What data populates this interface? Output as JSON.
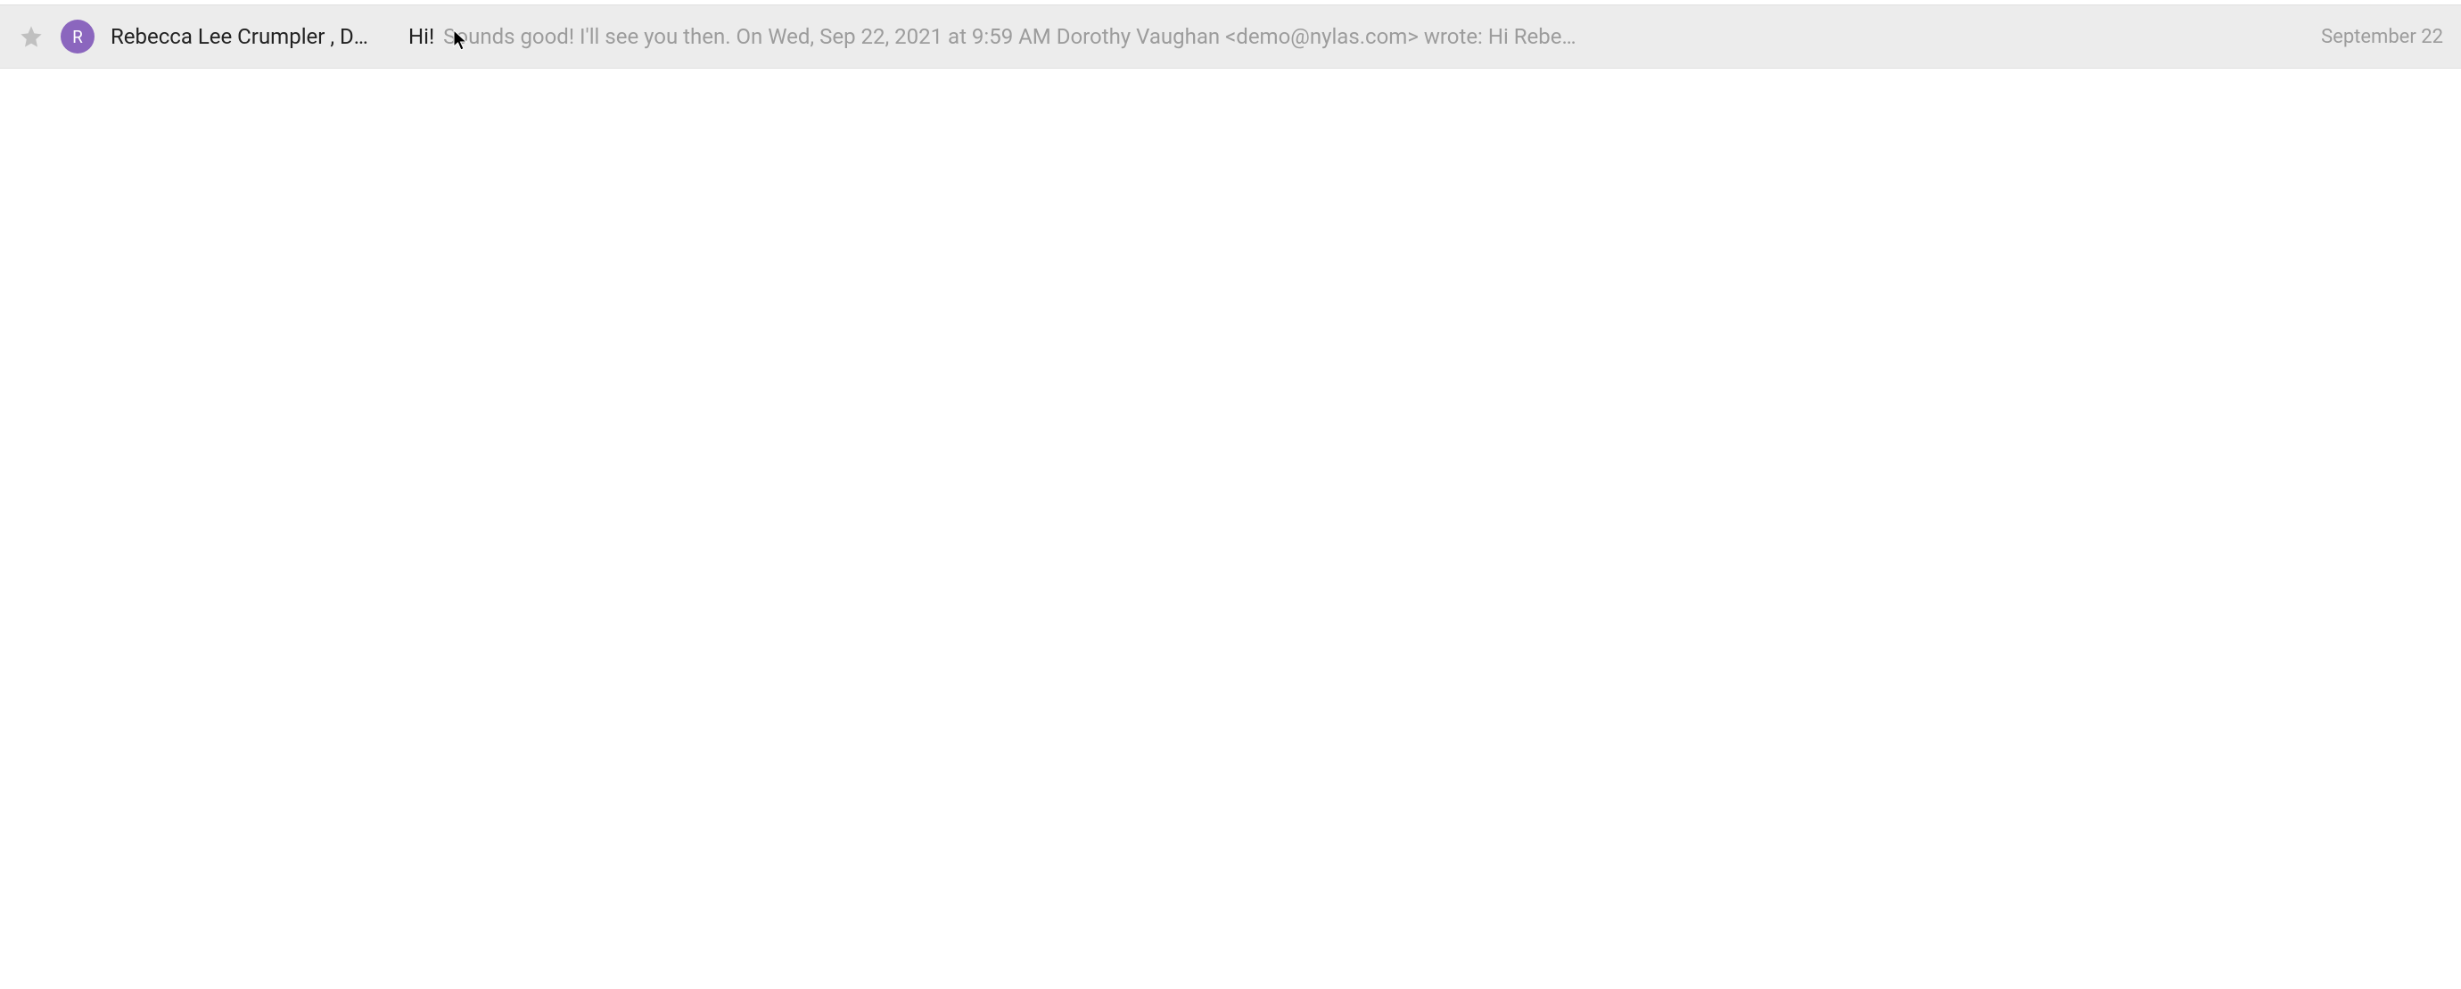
{
  "email": {
    "avatar_initial": "R",
    "avatar_color": "#8b66be",
    "sender": "Rebecca Lee Crumpler , Dorothy",
    "subject": "Hi!",
    "snippet": "Sounds good! I'll see you then. On Wed, Sep 22, 2021 at 9:59 AM Dorothy Vaughan <demo@nylas.com> wrote: Hi Rebe…",
    "date": "September 22"
  }
}
